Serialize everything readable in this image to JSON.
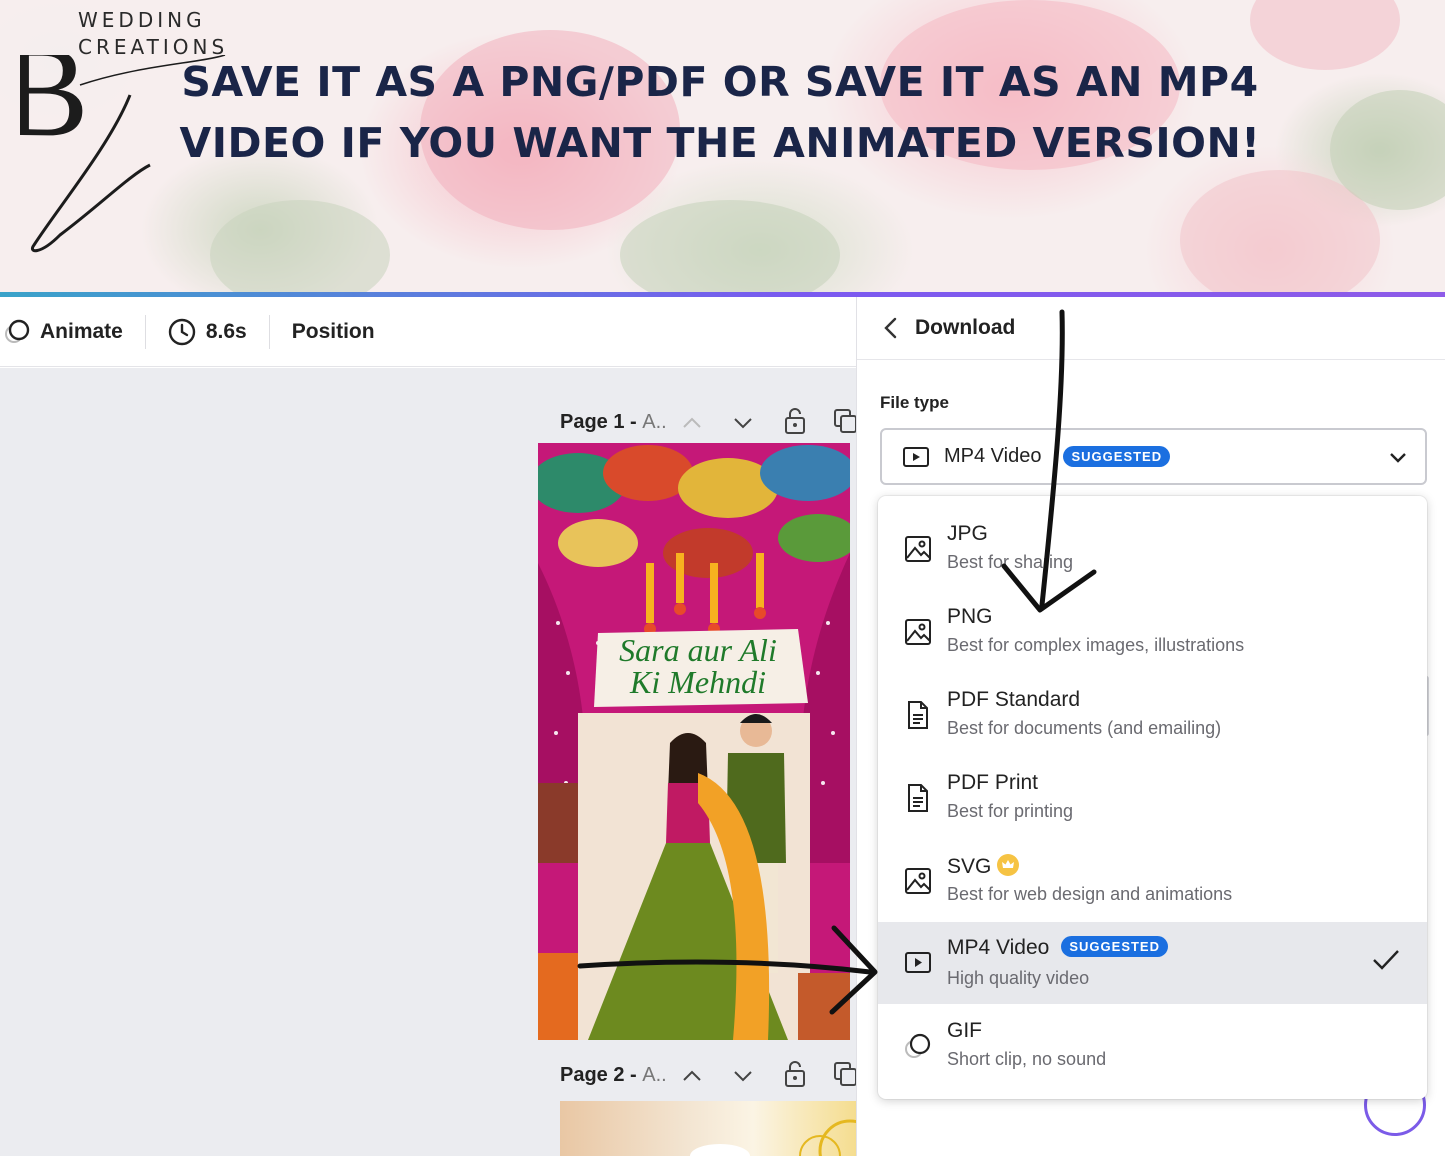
{
  "banner": {
    "logo_letters": "BL",
    "logo_line1": "WEDDING",
    "logo_line2": "CREATIONS",
    "headline_line1": "SAVE IT AS A PNG/PDF OR SAVE IT AS AN MP4",
    "headline_line2": "VIDEO IF YOU WANT THE ANIMATED VERSION!"
  },
  "toolbar": {
    "animate_label": "Animate",
    "duration_label": "8.6s",
    "position_label": "Position"
  },
  "canvas": {
    "page1": {
      "label": "Page 1 - ",
      "suffix": "A.."
    },
    "page2": {
      "label": "Page 2 - ",
      "suffix": "A.."
    }
  },
  "design": {
    "title_line1": "Sara aur Ali",
    "title_line2": "Ki Mehndi"
  },
  "panel": {
    "title": "Download",
    "file_type_label": "File type",
    "selected_value": "MP4 Video",
    "selected_badge": "SUGGESTED"
  },
  "options": [
    {
      "name": "JPG",
      "desc": "Best for sharing",
      "icon": "image-icon"
    },
    {
      "name": "PNG",
      "desc": "Best for complex images, illustrations",
      "icon": "image-icon"
    },
    {
      "name": "PDF Standard",
      "desc": "Best for documents (and emailing)",
      "icon": "document-icon"
    },
    {
      "name": "PDF Print",
      "desc": "Best for printing",
      "icon": "document-icon"
    },
    {
      "name": "SVG",
      "desc": "Best for web design and animations",
      "icon": "image-icon"
    },
    {
      "name": "MP4 Video",
      "desc": "High quality video",
      "icon": "video-icon",
      "badge": "SUGGESTED",
      "selected": true
    },
    {
      "name": "GIF",
      "desc": "Short clip, no sound",
      "icon": "gif-icon"
    }
  ],
  "colors": {
    "headline": "#1a2548",
    "accent_blue": "#1b6fe0",
    "design_pink": "#c7157a",
    "selected_row": "#e7e8ec"
  }
}
